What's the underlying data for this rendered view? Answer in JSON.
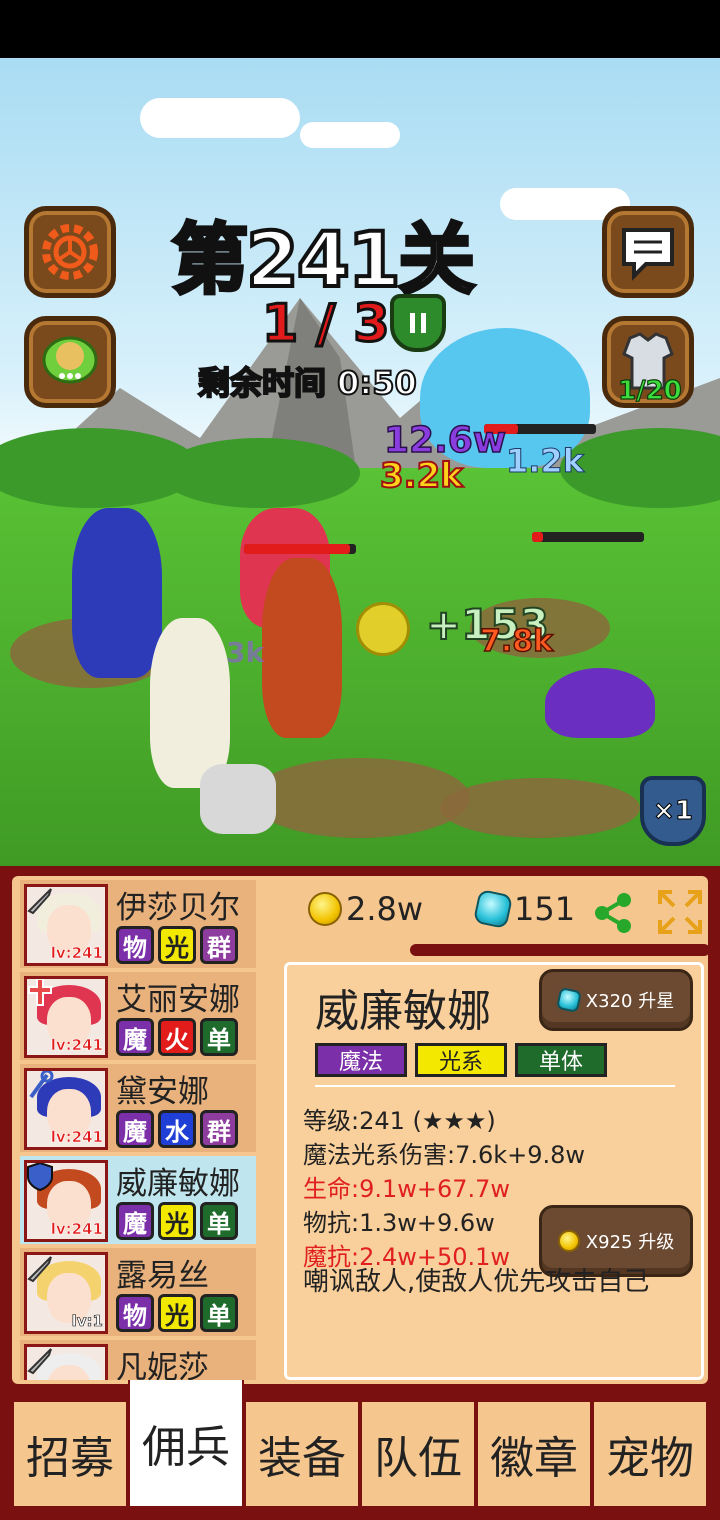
{
  "stage": {
    "title": "第241关",
    "wave": "1 / 3",
    "timer_label": "剩余时间 0:50",
    "unit_count": "1/20",
    "speed": "×1"
  },
  "battle": {
    "damage_numbers": [
      "12.6w",
      "3.2k",
      "1.2k",
      "+153",
      "7.8k",
      "3k"
    ]
  },
  "resources": {
    "gold": "2.8w",
    "gems": "151"
  },
  "heroes": [
    {
      "name": "伊莎贝尔",
      "level": "lv:241",
      "tags": [
        "物",
        "光",
        "群"
      ],
      "hair": "#f2eede",
      "role": "sword"
    },
    {
      "name": "艾丽安娜",
      "level": "lv:241",
      "tags": [
        "魔",
        "火",
        "单"
      ],
      "hair": "#e03550",
      "role": "cross"
    },
    {
      "name": "黛安娜",
      "level": "lv:241",
      "tags": [
        "魔",
        "水",
        "群"
      ],
      "hair": "#2e3bb8",
      "role": "staff"
    },
    {
      "name": "威廉敏娜",
      "level": "lv:241",
      "tags": [
        "魔",
        "光",
        "单"
      ],
      "hair": "#c24a1e",
      "role": "shield"
    },
    {
      "name": "露易丝",
      "level": "lv:1",
      "tags": [
        "物",
        "光",
        "单"
      ],
      "hair": "#f4d36e",
      "role": "sword"
    },
    {
      "name": "凡妮莎",
      "level": "",
      "tags": [],
      "hair": "#eeeeee",
      "role": "sword"
    }
  ],
  "detail": {
    "name": "威廉敏娜",
    "tags": [
      "魔法",
      "光系",
      "单体"
    ],
    "star_up": "X320 升星",
    "level_up": "X925 升级",
    "stats": {
      "level": "等级:241 (★★★)",
      "damage": "魔法光系伤害:7.6k+9.8w",
      "hp": "生命:9.1w+67.7w",
      "phys_def": "物抗:1.3w+9.6w",
      "mag_def": "魔抗:2.4w+50.1w"
    },
    "skill": "嘲讽敌人,使敌人优先攻击自己"
  },
  "tabs": [
    "招募",
    "佣兵",
    "装备",
    "队伍",
    "徽章",
    "宠物"
  ],
  "colors": {
    "tag_phys": "#7b2fa8",
    "tag_magic": "#7b2fa8",
    "tag_light": "#f3e800",
    "tag_fire": "#e21b1b",
    "tag_water": "#1f3fd6",
    "tag_group": "#8e3c9e",
    "tag_single": "#1f6b2c"
  }
}
